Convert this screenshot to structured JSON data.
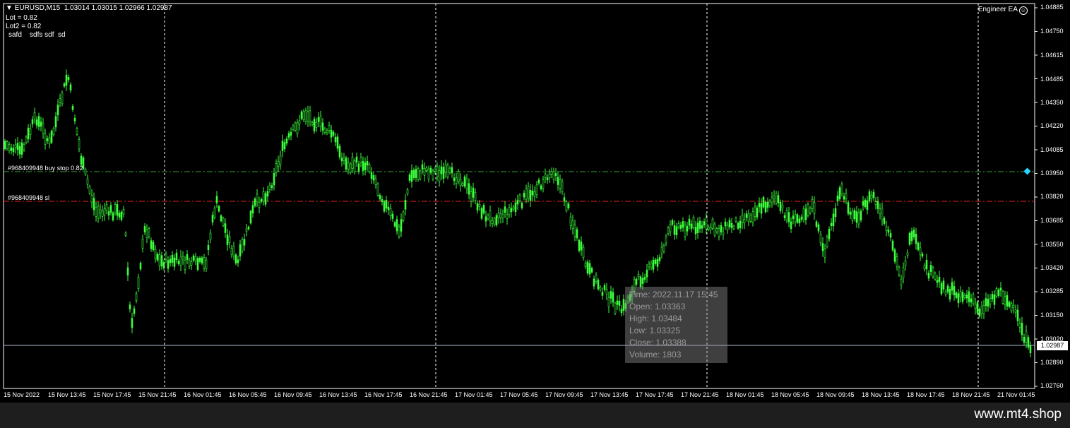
{
  "chart": {
    "header": "▼ EURUSD,M15  1.03014 1.03015 1.02966 1.02987",
    "lot": "Lot = 0.82",
    "lot2": "Lot2 = 0.82",
    "custom": "safd    sdfs sdf  sd",
    "ea_name": "Engineer EA",
    "price_axis": [
      "1.04885",
      "1.04750",
      "1.04615",
      "1.04485",
      "1.04350",
      "1.04220",
      "1.04085",
      "1.03950",
      "1.03820",
      "1.03685",
      "1.03550",
      "1.03420",
      "1.03285",
      "1.03150",
      "1.03020",
      "1.02890",
      "1.02760"
    ],
    "current_price": "1.02987",
    "time_axis": [
      "15 Nov 2022",
      "15 Nov 13:45",
      "15 Nov 17:45",
      "15 Nov 21:45",
      "16 Nov 01:45",
      "16 Nov 05:45",
      "16 Nov 09:45",
      "16 Nov 13:45",
      "16 Nov 17:45",
      "16 Nov 21:45",
      "17 Nov 01:45",
      "17 Nov 05:45",
      "17 Nov 09:45",
      "17 Nov 13:45",
      "17 Nov 17:45",
      "17 Nov 21:45",
      "18 Nov 01:45",
      "18 Nov 05:45",
      "18 Nov 09:45",
      "18 Nov 13:45",
      "18 Nov 17:45",
      "18 Nov 21:45",
      "21 Nov 01:45"
    ],
    "orders": {
      "buy_stop": "#968409948 buy stop 0.82",
      "sl": "#968409948 sl"
    },
    "tooltip": {
      "time": "Time: 2022.11.17 15:45",
      "open": "Open: 1.03363",
      "high": "High: 1.03484",
      "low": "Low:  1.03325",
      "close": "Close: 1.03388",
      "volume": "Volume: 1803"
    },
    "colors": {
      "candles": "#3cff3c",
      "buy_stop_line": "#36a836",
      "sl_line": "#e02020",
      "grid": "#ffffff"
    }
  },
  "footer": {
    "watermark": "www.mt4.shop"
  }
}
